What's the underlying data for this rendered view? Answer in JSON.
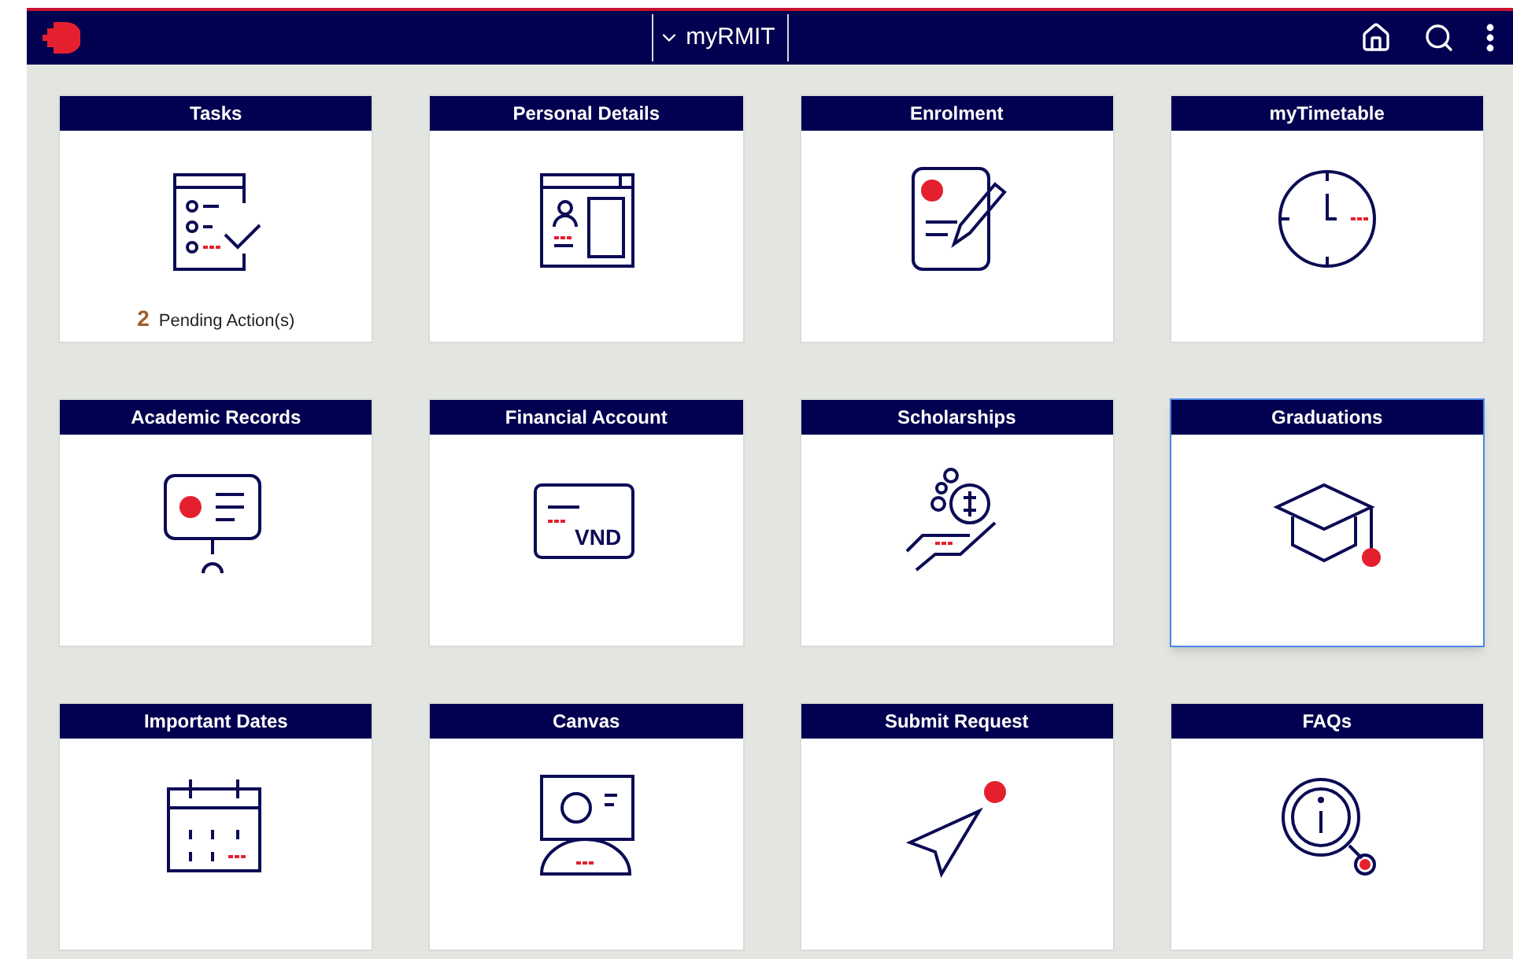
{
  "header": {
    "title": "myRMIT"
  },
  "tiles": [
    {
      "title": "Tasks",
      "kind": "tasks",
      "selected": false,
      "count": "2",
      "note": "Pending Action(s)"
    },
    {
      "title": "Personal Details",
      "kind": "profile",
      "selected": false
    },
    {
      "title": "Enrolment",
      "kind": "enrolment",
      "selected": false
    },
    {
      "title": "myTimetable",
      "kind": "clock",
      "selected": false
    },
    {
      "title": "Academic Records",
      "kind": "records",
      "selected": false
    },
    {
      "title": "Financial Account",
      "kind": "card",
      "selected": false,
      "icon_text": "VND"
    },
    {
      "title": "Scholarships",
      "kind": "scholarship",
      "selected": false
    },
    {
      "title": "Graduations",
      "kind": "graduation",
      "selected": true
    },
    {
      "title": "Important Dates",
      "kind": "calendar",
      "selected": false
    },
    {
      "title": "Canvas",
      "kind": "canvas",
      "selected": false
    },
    {
      "title": "Submit Request",
      "kind": "send",
      "selected": false
    },
    {
      "title": "FAQs",
      "kind": "faq",
      "selected": false
    }
  ]
}
